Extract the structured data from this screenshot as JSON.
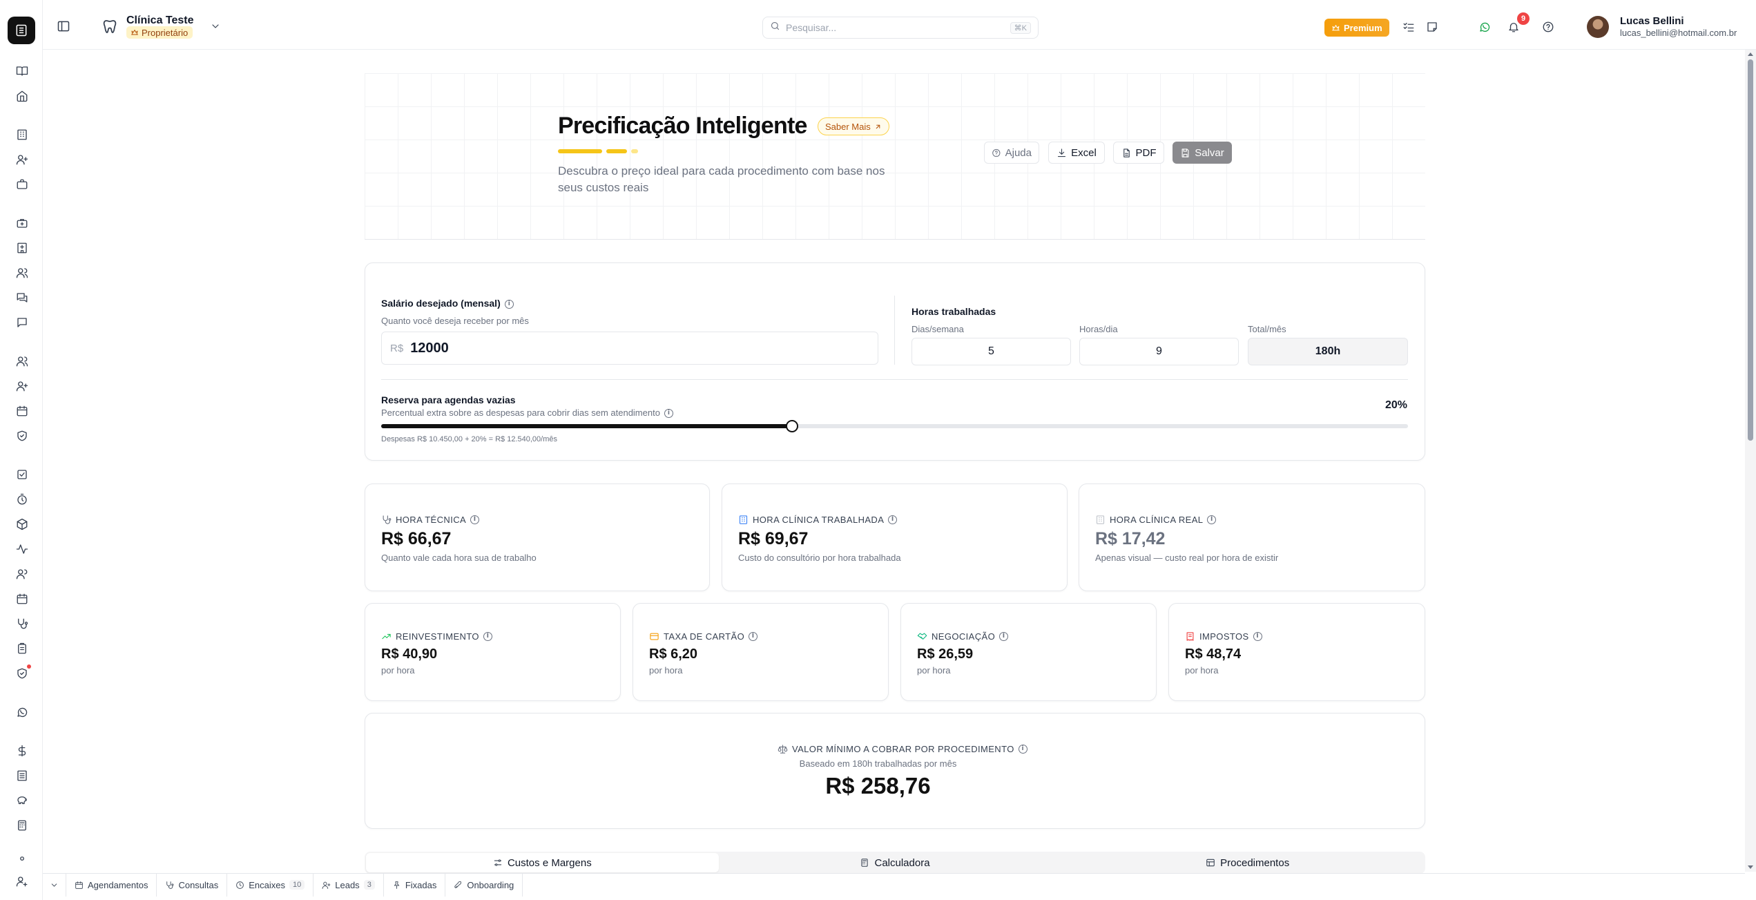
{
  "header": {
    "clinic_name": "Clínica Teste",
    "role_badge": "Proprietário",
    "search_placeholder": "Pesquisar...",
    "search_shortcut": "⌘K",
    "premium_label": "Premium",
    "notifications_count": "9",
    "user_name": "Lucas Bellini",
    "user_email": "lucas_bellini@hotmail.com.br"
  },
  "hero": {
    "title": "Precificação Inteligente",
    "saber_mais": "Saber Mais",
    "subtitle": "Descubra o preço ideal para cada procedimento com base nos seus custos reais",
    "buttons": {
      "help": "Ajuda",
      "excel": "Excel",
      "pdf": "PDF",
      "save": "Salvar"
    }
  },
  "salary": {
    "label": "Salário desejado (mensal)",
    "sublabel": "Quanto você deseja receber por mês",
    "currency": "R$",
    "value": "12000"
  },
  "hours": {
    "title": "Horas trabalhadas",
    "days_label": "Dias/semana",
    "days_value": "5",
    "per_day_label": "Horas/dia",
    "per_day_value": "9",
    "total_label": "Total/mês",
    "total_value": "180h"
  },
  "reserve": {
    "label": "Reserva para agendas vazias",
    "sublabel": "Percentual extra sobre as despesas para cobrir dias sem atendimento",
    "percent_label": "20%",
    "slider_fraction": 0.4,
    "formula": "Despesas R$ 10.450,00 + 20% = R$ 12.540,00/mês"
  },
  "metrics": {
    "hora_tecnica": {
      "label": "Hora Técnica",
      "value": "R$ 66,67",
      "desc": "Quanto vale cada hora sua de trabalho"
    },
    "hora_clinica_trabalhada": {
      "label": "Hora Clínica Trabalhada",
      "value": "R$ 69,67",
      "desc": "Custo do consultório por hora trabalhada"
    },
    "hora_clinica_real": {
      "label": "Hora Clínica Real",
      "value": "R$ 17,42",
      "desc": "Apenas visual — custo real por hora de existir"
    },
    "reinvestimento": {
      "label": "Reinvestimento",
      "value": "R$ 40,90",
      "desc": "por hora"
    },
    "taxa_cartao": {
      "label": "Taxa de Cartão",
      "value": "R$ 6,20",
      "desc": "por hora"
    },
    "negociacao": {
      "label": "Negociação",
      "value": "R$ 26,59",
      "desc": "por hora"
    },
    "impostos": {
      "label": "Impostos",
      "value": "R$ 48,74",
      "desc": "por hora"
    }
  },
  "minimum": {
    "label": "VALOR MÍNIMO A COBRAR POR PROCEDIMENTO",
    "sub": "Baseado em 180h trabalhadas por mês",
    "value": "R$ 258,76"
  },
  "tabs": [
    "Custos e Margens",
    "Calculadora",
    "Procedimentos"
  ],
  "bottombar": {
    "agendamentos": "Agendamentos",
    "consultas": "Consultas",
    "encaixes": "Encaixes",
    "encaixes_count": "10",
    "leads": "Leads",
    "leads_count": "3",
    "fixadas": "Fixadas",
    "onboarding": "Onboarding"
  },
  "colors": {
    "accent_black": "#111111",
    "premium": "#f59e0b",
    "badge_bg": "#fef3c7",
    "notification": "#ef4444",
    "save_button": "#8a8a8e"
  }
}
